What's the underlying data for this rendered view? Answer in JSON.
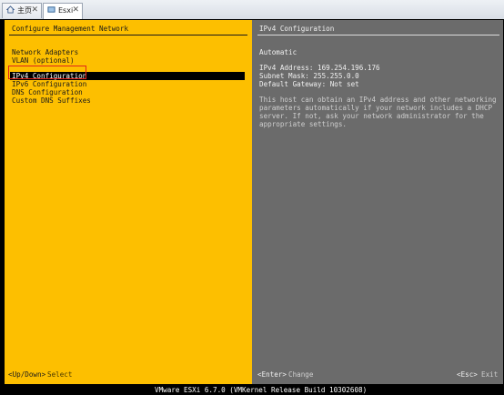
{
  "tabs": [
    {
      "label": "主页",
      "icon": "home-icon",
      "close": "✕"
    },
    {
      "label": "Esxi",
      "icon": "vm-icon",
      "close": "✕"
    }
  ],
  "left_panel": {
    "title": "Configure Management Network",
    "menu": [
      "Network Adapters",
      "VLAN (optional)",
      "IPv4 Configuration",
      "IPv6 Configuration",
      "DNS Configuration",
      "Custom DNS Suffixes"
    ],
    "selected_index": 2,
    "hint_key": "<Up/Down>",
    "hint_action": "Select"
  },
  "right_panel": {
    "title": "IPv4 Configuration",
    "mode": "Automatic",
    "ipv4_address": "IPv4 Address: 169.254.196.176",
    "subnet_mask": "Subnet Mask: 255.255.0.0",
    "default_gateway": "Default Gateway: Not set",
    "description": [
      "This host can obtain an IPv4 address and other networking",
      "parameters automatically if your network includes a DHCP",
      "server. If not, ask your network administrator for the",
      "appropriate settings."
    ],
    "enter_key": "<Enter>",
    "enter_action": "Change",
    "esc_key": "<Esc>",
    "esc_action": "Exit"
  },
  "footer": {
    "text": "VMware ESXi 6.7.0 (VMKernel Release Build 10302608)"
  },
  "colors": {
    "left_bg": "#fdbf00",
    "right_bg": "#6b6b6b",
    "highlight": "#e0251b"
  }
}
